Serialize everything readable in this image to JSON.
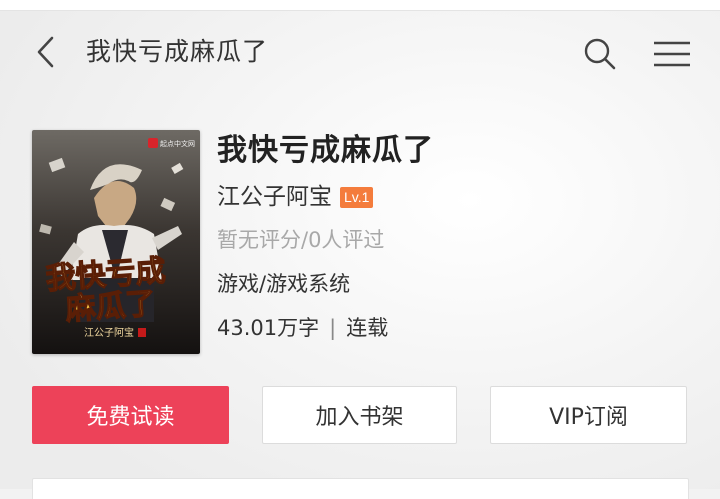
{
  "header": {
    "title": "我快亏成麻瓜了",
    "back_icon": "chevron-left-icon",
    "search_icon": "search-icon",
    "menu_icon": "hamburger-menu-icon"
  },
  "book": {
    "title": "我快亏成麻瓜了",
    "author": "江公子阿宝",
    "level": "Lv.1",
    "rating": "暂无评分/0人评过",
    "category": "游戏/游戏系统",
    "word_count": "43.01万字",
    "separator": "|",
    "status": "连载",
    "cover": {
      "publisher": "起点中文网",
      "title_line1": "我快亏成",
      "title_line2": "麻瓜了",
      "author": "江公子阿宝"
    }
  },
  "actions": {
    "read": "免费试读",
    "shelf": "加入书架",
    "vip": "VIP订阅"
  },
  "colors": {
    "accent": "#ed4259",
    "level_badge": "#f47c3c"
  }
}
